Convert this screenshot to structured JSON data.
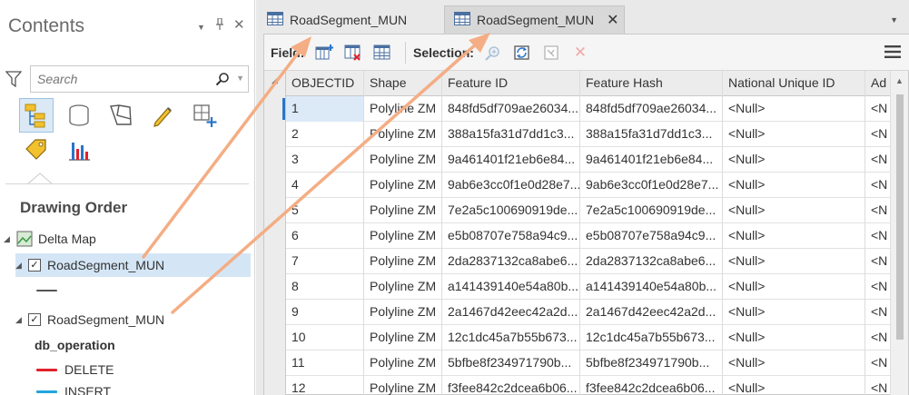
{
  "contents": {
    "title": "Contents",
    "pane_controls": {
      "options": "▼",
      "pin": "📌",
      "close": "✕"
    },
    "search": {
      "placeholder": "Search",
      "value": ""
    },
    "drawing_order": "Drawing Order",
    "tree": {
      "map_name": "Delta Map",
      "layer1": "RoadSegment_MUN",
      "layer2": "RoadSegment_MUN",
      "legend_field": "db_operation",
      "legend_items": [
        {
          "label": "DELETE",
          "color": "#e0222b"
        },
        {
          "label": "INSERT",
          "color": "#22a5dd"
        }
      ],
      "layer1_symbol_color": "#555555"
    }
  },
  "tabs": [
    {
      "label": "RoadSegment_MUN",
      "active": false
    },
    {
      "label": "RoadSegment_MUN",
      "active": true,
      "close": "✕"
    }
  ],
  "toolbar": {
    "field_label": "Field:",
    "selection_label": "Selection:"
  },
  "table": {
    "columns": [
      "OBJECTID",
      "Shape",
      "Feature ID",
      "Feature Hash",
      "National Unique ID",
      "Ad"
    ],
    "rows": [
      [
        "1",
        "Polyline ZM",
        "848fd5df709ae26034...",
        "848fd5df709ae26034...",
        "<Null>",
        "<N"
      ],
      [
        "2",
        "Polyline ZM",
        "388a15fa31d7dd1c3...",
        "388a15fa31d7dd1c3...",
        "<Null>",
        "<N"
      ],
      [
        "3",
        "Polyline ZM",
        "9a461401f21eb6e84...",
        "9a461401f21eb6e84...",
        "<Null>",
        "<N"
      ],
      [
        "4",
        "Polyline ZM",
        "9ab6e3cc0f1e0d28e7...",
        "9ab6e3cc0f1e0d28e7...",
        "<Null>",
        "<N"
      ],
      [
        "5",
        "Polyline ZM",
        "7e2a5c100690919de...",
        "7e2a5c100690919de...",
        "<Null>",
        "<N"
      ],
      [
        "6",
        "Polyline ZM",
        "e5b08707e758a94c9...",
        "e5b08707e758a94c9...",
        "<Null>",
        "<N"
      ],
      [
        "7",
        "Polyline ZM",
        "2da2837132ca8abe6...",
        "2da2837132ca8abe6...",
        "<Null>",
        "<N"
      ],
      [
        "8",
        "Polyline ZM",
        "a141439140e54a80b...",
        "a141439140e54a80b...",
        "<Null>",
        "<N"
      ],
      [
        "9",
        "Polyline ZM",
        "2a1467d42eec42a2d...",
        "2a1467d42eec42a2d...",
        "<Null>",
        "<N"
      ],
      [
        "10",
        "Polyline ZM",
        "12c1dc45a7b55b673...",
        "12c1dc45a7b55b673...",
        "<Null>",
        "<N"
      ],
      [
        "11",
        "Polyline ZM",
        "5bfbe8f234971790b...",
        "5bfbe8f234971790b...",
        "<Null>",
        "<N"
      ],
      [
        "12",
        "Polyline ZM",
        "f3fee842c2dcea6b06...",
        "f3fee842c2dcea6b06...",
        "<Null>",
        "<N"
      ]
    ]
  },
  "colors": {
    "accent": "#2a74c9",
    "selection": "#d4e6f6",
    "annotation_arrow": "#f4ad84"
  }
}
